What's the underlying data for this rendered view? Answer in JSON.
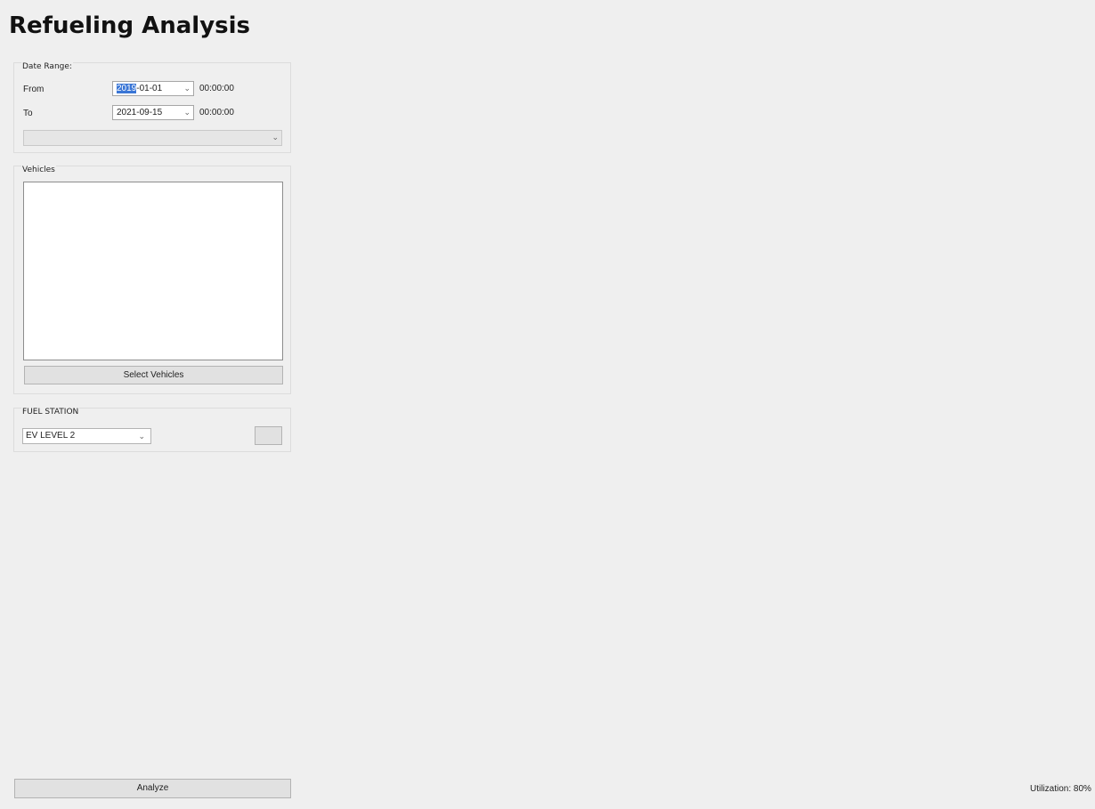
{
  "app": {
    "title": "Refueling Analysis"
  },
  "date_range": {
    "legend": "Date Range:",
    "from_label": "From",
    "from_date_selected": "2019",
    "from_date_rest": "-01-01",
    "from_time": "00:00:00",
    "to_label": "To",
    "to_date": "2021-09-15",
    "to_time": "00:00:00",
    "preset_value": "",
    "chevron_icon": "chevron-down-icon"
  },
  "vehicles": {
    "legend": "Vehicles",
    "items": [],
    "select_button_label": "Select Vehicles"
  },
  "fuel_station": {
    "legend": "FUEL STATION",
    "selected_option": "EV LEVEL 2",
    "chevron_icon": "chevron-down-icon"
  },
  "footer": {
    "analyze_label": "Analyze",
    "status_text": "Utilization: 80%"
  },
  "colors": {
    "background": "#efefef",
    "selection_highlight": "#3a76d6"
  }
}
